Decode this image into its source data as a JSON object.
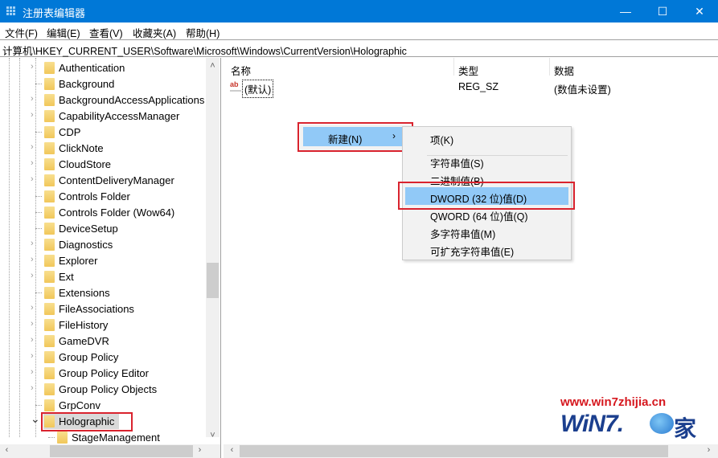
{
  "window": {
    "title": "注册表编辑器",
    "minimize_label": "—",
    "maximize_label": "☐",
    "close_label": "✕",
    "accent": "#0078d7"
  },
  "menubar": {
    "items": [
      "文件(F)",
      "编辑(E)",
      "查看(V)",
      "收藏夹(A)",
      "帮助(H)"
    ]
  },
  "address": {
    "path": "计算机\\HKEY_CURRENT_USER\\Software\\Microsoft\\Windows\\CurrentVersion\\Holographic"
  },
  "tree": {
    "items": [
      {
        "label": "Authentication",
        "expandable": true
      },
      {
        "label": "Background",
        "expandable": false
      },
      {
        "label": "BackgroundAccessApplications",
        "expandable": true
      },
      {
        "label": "CapabilityAccessManager",
        "expandable": true
      },
      {
        "label": "CDP",
        "expandable": false
      },
      {
        "label": "ClickNote",
        "expandable": true
      },
      {
        "label": "CloudStore",
        "expandable": true
      },
      {
        "label": "ContentDeliveryManager",
        "expandable": true
      },
      {
        "label": "Controls Folder",
        "expandable": false
      },
      {
        "label": "Controls Folder (Wow64)",
        "expandable": false
      },
      {
        "label": "DeviceSetup",
        "expandable": false
      },
      {
        "label": "Diagnostics",
        "expandable": true
      },
      {
        "label": "Explorer",
        "expandable": true
      },
      {
        "label": "Ext",
        "expandable": true
      },
      {
        "label": "Extensions",
        "expandable": false
      },
      {
        "label": "FileAssociations",
        "expandable": true
      },
      {
        "label": "FileHistory",
        "expandable": true
      },
      {
        "label": "GameDVR",
        "expandable": true
      },
      {
        "label": "Group Policy",
        "expandable": true
      },
      {
        "label": "Group Policy Editor",
        "expandable": true
      },
      {
        "label": "Group Policy Objects",
        "expandable": true
      },
      {
        "label": "GrpConv",
        "expandable": false
      },
      {
        "label": "Holographic",
        "expandable": true,
        "expanded": true,
        "selected": true
      },
      {
        "label": "StageManagement",
        "expandable": false,
        "child": true
      }
    ]
  },
  "values_table": {
    "columns": [
      "名称",
      "类型",
      "数据"
    ],
    "rows": [
      {
        "name": "(默认)",
        "type": "REG_SZ",
        "data": "(数值未设置)",
        "icon": "ab-string-icon"
      }
    ]
  },
  "context_menu": {
    "new_label": "新建(N)",
    "new_chevron": "›",
    "submenu": [
      {
        "label": "项(K)"
      },
      {
        "label": "字符串值(S)"
      },
      {
        "label": "二进制值(B)"
      },
      {
        "label": "DWORD (32 位)值(D)",
        "highlighted": true
      },
      {
        "label": "QWORD (64 位)值(Q)"
      },
      {
        "label": "多字符串值(M)"
      },
      {
        "label": "可扩充字符串值(E)"
      }
    ]
  },
  "watermark": {
    "url": "www.win7zhijia.cn",
    "logo_text": "WiN7.",
    "logo_suffix": "家"
  },
  "scroll": {
    "tree_up": "˄",
    "tree_down": "˅",
    "left": "‹",
    "right": "›"
  }
}
